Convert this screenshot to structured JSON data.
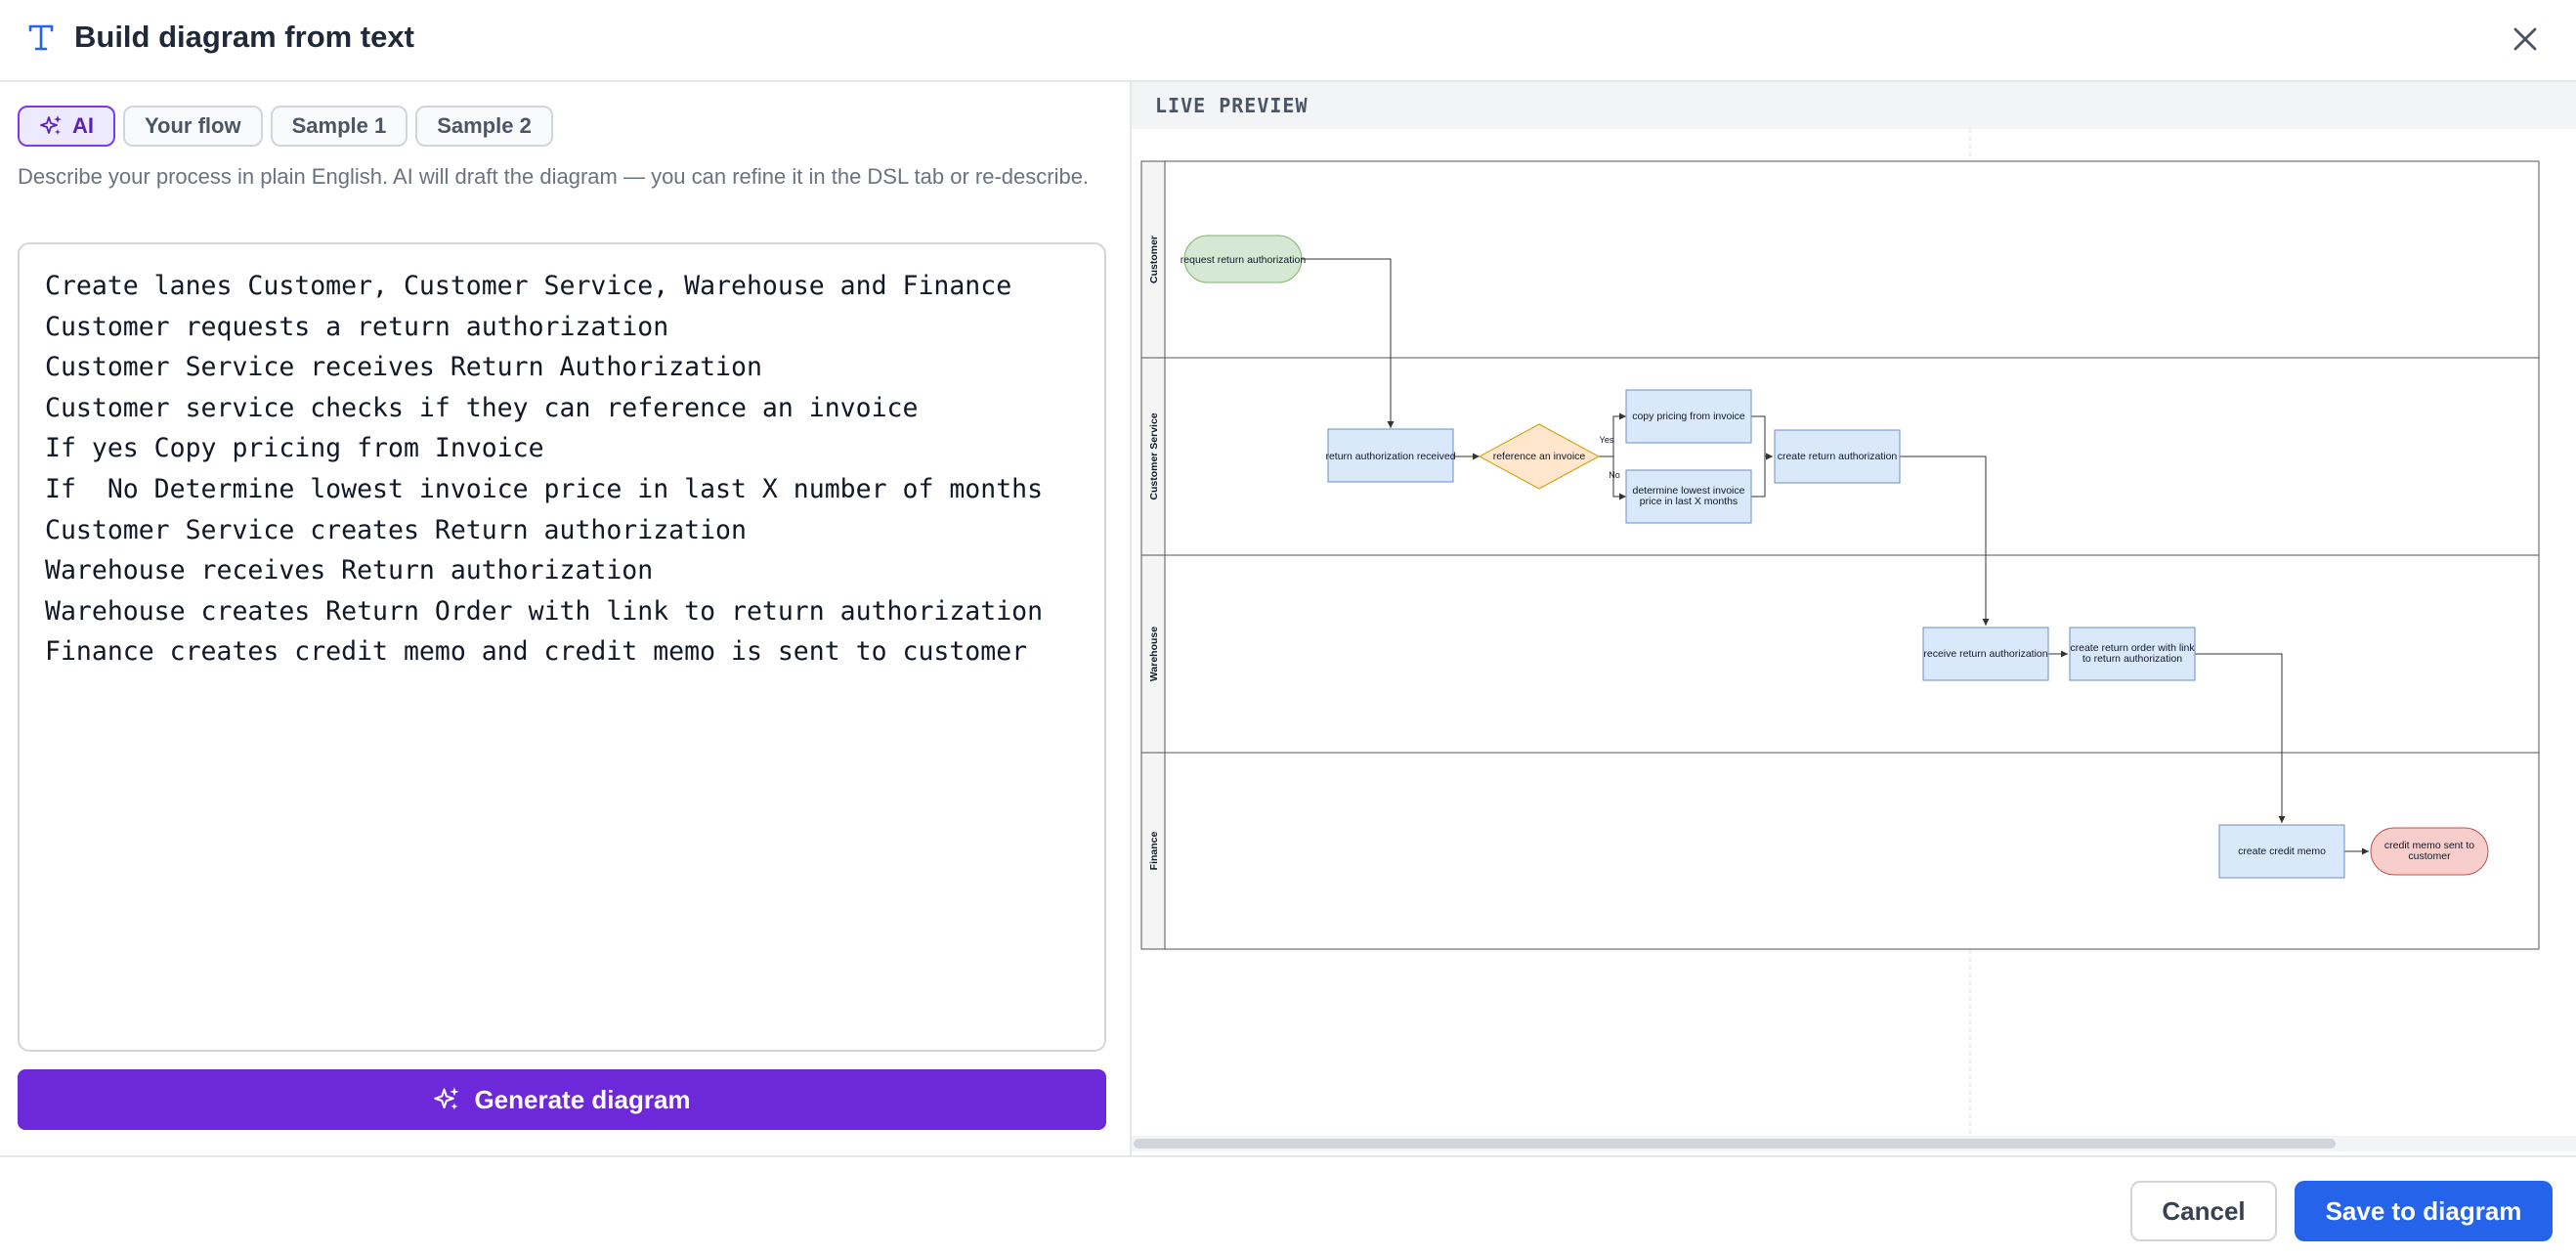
{
  "dialog": {
    "title": "Build diagram from text",
    "title_icon": "text-t-icon",
    "close_icon": "close-icon"
  },
  "tabs": [
    {
      "label": "AI",
      "icon": "sparkles-icon",
      "active": true
    },
    {
      "label": "Your flow",
      "active": false
    },
    {
      "label": "Sample 1",
      "active": false
    },
    {
      "label": "Sample 2",
      "active": false
    }
  ],
  "description": "Describe your process in plain English. AI will draft the diagram — you can refine it in the DSL tab or re-describe.",
  "input_text": "Create lanes Customer, Customer Service, Warehouse and Finance\nCustomer requests a return authorization\nCustomer Service receives Return Authorization\nCustomer service checks if they can reference an invoice\nIf yes Copy pricing from Invoice\nIf  No Determine lowest invoice price in last X number of months\nCustomer Service creates Return authorization\nWarehouse receives Return authorization\nWarehouse creates Return Order with link to return authorization\nFinance creates credit memo and credit memo is sent to customer",
  "generate_button": {
    "label": "Generate diagram",
    "icon": "sparkles-icon"
  },
  "preview": {
    "label": "LIVE PREVIEW",
    "lanes": [
      "Customer",
      "Customer Service",
      "Warehouse",
      "Finance"
    ],
    "nodes": {
      "n1": {
        "lines": [
          "request return authorization"
        ],
        "shape": "terminal",
        "color": "#d5e8d4"
      },
      "n2": {
        "lines": [
          "return authorization received"
        ],
        "shape": "process",
        "color": "#dae8fc"
      },
      "n3": {
        "lines": [
          "reference an invoice"
        ],
        "shape": "decision",
        "color": "#ffe6cc"
      },
      "n4": {
        "lines": [
          "copy pricing from invoice"
        ],
        "shape": "process",
        "color": "#dae8fc"
      },
      "n5": {
        "lines": [
          "determine lowest invoice",
          "price in last X months"
        ],
        "shape": "process",
        "color": "#dae8fc"
      },
      "n6": {
        "lines": [
          "create return authorization"
        ],
        "shape": "process",
        "color": "#dae8fc"
      },
      "n7": {
        "lines": [
          "receive return authorization"
        ],
        "shape": "process",
        "color": "#dae8fc"
      },
      "n8": {
        "lines": [
          "create return order with link",
          "to return authorization"
        ],
        "shape": "process",
        "color": "#dae8fc"
      },
      "n9": {
        "lines": [
          "create credit memo"
        ],
        "shape": "process",
        "color": "#dae8fc"
      },
      "n10": {
        "lines": [
          "credit memo sent to",
          "customer"
        ],
        "shape": "terminal",
        "color": "#f8cecc"
      }
    },
    "edge_labels": {
      "yes": "Yes",
      "no": "No"
    }
  },
  "footer": {
    "cancel_label": "Cancel",
    "save_label": "Save to diagram"
  },
  "colors": {
    "accent_purple": "#6d28d9",
    "primary_blue": "#2563eb"
  }
}
